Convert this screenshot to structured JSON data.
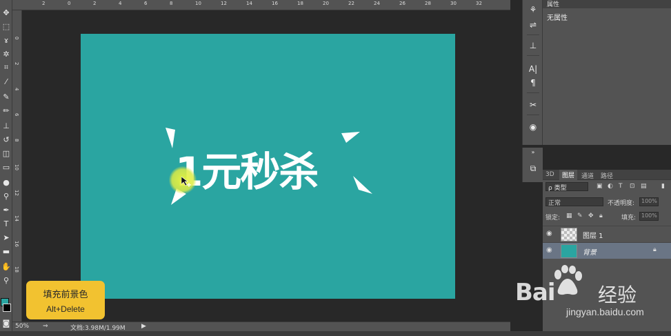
{
  "app": {
    "accent_color": "#2aa5a1",
    "tip_color": "#f2c230"
  },
  "ruler": {
    "top_ticks": [
      "2",
      "0",
      "2",
      "4",
      "6",
      "8",
      "10",
      "12",
      "14",
      "16",
      "18",
      "20",
      "22",
      "24",
      "26",
      "28",
      "30",
      "32"
    ],
    "left_ticks": [
      "0",
      "2",
      "4",
      "6",
      "8",
      "10",
      "12",
      "14",
      "16",
      "18"
    ]
  },
  "canvas": {
    "background_color": "#2aa5a1",
    "headline_text": "1元秒杀"
  },
  "tip": {
    "title": "填充前景色",
    "shortcut": "Alt+Delete"
  },
  "status": {
    "zoom": "50%",
    "doc_size": "文档:3.98M/1.99M"
  },
  "properties": {
    "tab_label": "属性",
    "empty_text": "无属性"
  },
  "layers": {
    "tabs": [
      "3D",
      "图层",
      "通道",
      "路径"
    ],
    "filter_label": "ρ 类型",
    "blend_mode": "正常",
    "opacity_label": "不透明度:",
    "opacity_value": "100%",
    "lock_label": "锁定:",
    "fill_label": "填充:",
    "fill_value": "100%",
    "items": [
      {
        "name": "图层 1",
        "selected": false,
        "locked": false
      },
      {
        "name": "背景",
        "selected": true,
        "locked": true
      }
    ]
  },
  "watermark": {
    "brand": "Bai",
    "brand2": "经验",
    "url": "jingyan.baidu.com"
  }
}
